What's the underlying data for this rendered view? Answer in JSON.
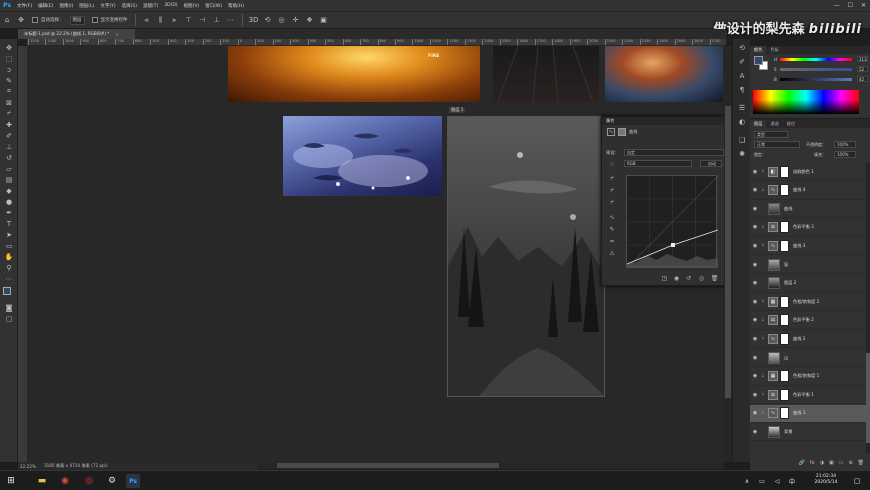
{
  "menu": {
    "app_icon": "Ps",
    "items": [
      "文件(F)",
      "编辑(E)",
      "图像(I)",
      "图层(L)",
      "文字(Y)",
      "选择(S)",
      "滤镜(T)",
      "3D(D)",
      "视图(V)",
      "窗口(W)",
      "帮助(H)"
    ],
    "window_controls": [
      "—",
      "☐",
      "✕"
    ]
  },
  "options": {
    "auto_select_label": "自动选择：",
    "auto_select_value": "图层",
    "show_transform_label": "显示变换控件"
  },
  "watermark": {
    "text": "做设计的梨先森",
    "brand": "bilibili"
  },
  "document": {
    "tab_title": "未标题-1.psd @ 22.2% (曲线 1, RGB/8#) *",
    "close": "×",
    "main_image_label": "图层 1",
    "fire_image_mark": "FIRE"
  },
  "ruler": {
    "ticks": [
      "1200",
      "1100",
      "1000",
      "900",
      "800",
      "700",
      "600",
      "500",
      "400",
      "300",
      "200",
      "100",
      "0",
      "100",
      "200",
      "300",
      "400",
      "500",
      "600",
      "700",
      "800",
      "900",
      "1000",
      "1100",
      "1200",
      "1300",
      "1400",
      "1500",
      "1600",
      "1700",
      "1800",
      "1900",
      "2000",
      "2100",
      "2200",
      "2300",
      "2400",
      "2500",
      "2600",
      "2700"
    ]
  },
  "properties": {
    "title": "属性",
    "panel_name": "曲线",
    "preset_label": "预设：",
    "preset_value": "自定",
    "channel_value": "RGB",
    "auto_button": "自动"
  },
  "status": {
    "zoom": "22.22%",
    "doc_info": "3185 像素 x 4710 像素 (72 ppi)"
  },
  "color": {
    "tabs": [
      "颜色",
      "色板"
    ],
    "labels": [
      "H",
      "S",
      "B"
    ],
    "values": [
      "213",
      "52",
      "42"
    ],
    "fg_color": "#354668",
    "bg_color": "#ffffff"
  },
  "layers_panel": {
    "tabs": [
      "图层",
      "通道",
      "路径"
    ],
    "filter_label": "类型",
    "blend_mode": "正常",
    "opacity_label": "不透明度：",
    "opacity_value": "100%",
    "lock_label": "锁定：",
    "fill_label": "填充：",
    "fill_value": "100%",
    "layers": [
      {
        "name": "选取颜色 1",
        "kind": "adj",
        "icon": "◧"
      },
      {
        "name": "曲线 4",
        "kind": "adj",
        "icon": "∿"
      },
      {
        "name": "曲线",
        "kind": "img",
        "icon": ""
      },
      {
        "name": "色彩平衡 3",
        "kind": "adj",
        "icon": "⚖"
      },
      {
        "name": "曲线 3",
        "kind": "adj",
        "icon": "∿"
      },
      {
        "name": "氛",
        "kind": "img",
        "icon": ""
      },
      {
        "name": "图层 2",
        "kind": "img",
        "icon": ""
      },
      {
        "name": "色相/饱和度 2",
        "kind": "adj",
        "icon": "▦"
      },
      {
        "name": "色彩平衡 2",
        "kind": "adj",
        "icon": "⚖"
      },
      {
        "name": "曲线 2",
        "kind": "adj",
        "icon": "∿"
      },
      {
        "name": "山",
        "kind": "img",
        "icon": ""
      },
      {
        "name": "色相/饱和度 1",
        "kind": "adj",
        "icon": "▦"
      },
      {
        "name": "色彩平衡 1",
        "kind": "adj",
        "icon": "⚖"
      },
      {
        "name": "曲线 1",
        "kind": "adj",
        "icon": "∿"
      },
      {
        "name": "背景",
        "kind": "img",
        "icon": ""
      }
    ],
    "footer_icons": [
      "fx",
      "◑",
      "▣",
      "▭",
      "⊕",
      "🗑"
    ]
  },
  "taskbar": {
    "time": "21:02:34",
    "date": "2020/5/14"
  }
}
